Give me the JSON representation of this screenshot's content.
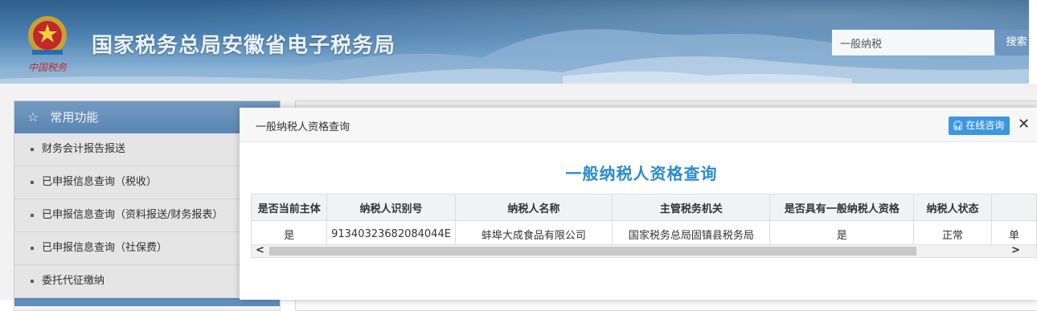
{
  "header": {
    "site_title": "国家税务总局安徽省电子税务局",
    "emblem_text": "中国税务",
    "search_placeholder": "一般纳税",
    "search_button": "搜索"
  },
  "sidebar": {
    "heading": "常用功能",
    "items": [
      {
        "label": "财务会计报告报送"
      },
      {
        "label": "已申报信息查询（税收）"
      },
      {
        "label": "已申报信息查询（资料报送/财务报表）"
      },
      {
        "label": "已申报信息查询（社保费）"
      },
      {
        "label": "委托代征缴纳"
      }
    ]
  },
  "dialog": {
    "title": "一般纳税人资格查询",
    "consult_button": "在线咨询",
    "heading": "一般纳税人资格查询",
    "columns": [
      "是否当前主体",
      "纳税人识别号",
      "纳税人名称",
      "主管税务机关",
      "是否具有一般纳税人资格",
      "纳税人状态",
      ""
    ],
    "rows": [
      [
        "是",
        "91340323682084044E",
        "蚌埠大成食品有限公司",
        "国家税务总局固镇县税务局",
        "是",
        "正常",
        "单"
      ]
    ]
  },
  "colors": {
    "accent": "#2a8bd0",
    "consult_button": "#3c97e0",
    "menu_header": "#6d97c6"
  },
  "icons": [
    "star-icon",
    "headset-icon",
    "close-icon",
    "scroll-left-icon",
    "scroll-right-icon"
  ]
}
